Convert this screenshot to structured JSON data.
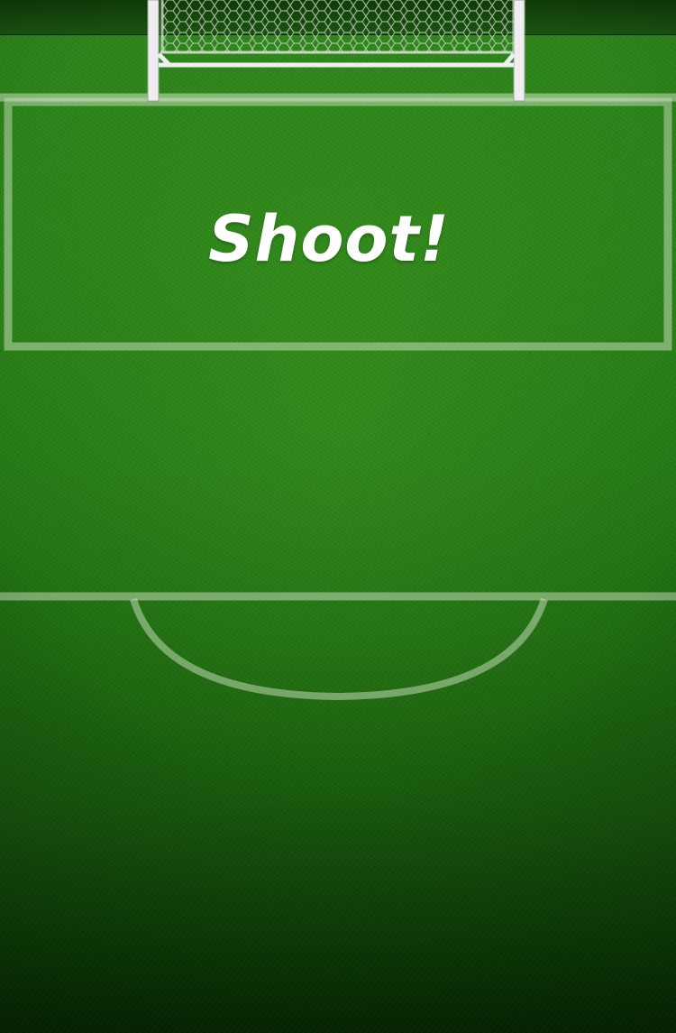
{
  "game": {
    "prompt_text": "Shoot!"
  },
  "colors": {
    "grass_light": "#2f8a1c",
    "grass_dark": "#072a04",
    "line": "#cfe3c4",
    "goal_frame": "#e8e8e8",
    "net": "#bfc9bb",
    "text": "#ffffff"
  },
  "icons": {
    "goal": "goal-net-icon"
  }
}
